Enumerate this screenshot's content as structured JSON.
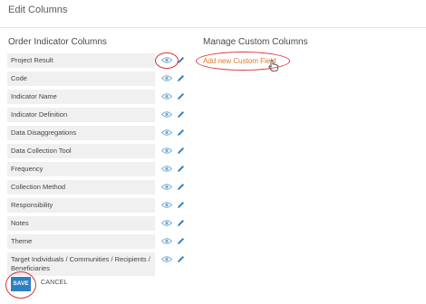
{
  "header": {
    "title": "Edit Columns"
  },
  "order_section": {
    "title": "Order Indicator Columns",
    "columns": [
      {
        "label": "Project Result"
      },
      {
        "label": "Code"
      },
      {
        "label": "Indicator Name"
      },
      {
        "label": "Indicator Definition"
      },
      {
        "label": "Data Disaggregations"
      },
      {
        "label": "Data Collection Tool"
      },
      {
        "label": "Frequency"
      },
      {
        "label": "Collection Method"
      },
      {
        "label": "Responsibility"
      },
      {
        "label": "Notes"
      },
      {
        "label": "Theme"
      },
      {
        "label": "Target Individuals / Communities / Recipients / Beneficiaries"
      }
    ]
  },
  "custom_section": {
    "title": "Manage Custom Columns",
    "add_link": "Add new Custom Field"
  },
  "footer": {
    "save_label": "SAVE",
    "cancel_label": "CANCEL"
  },
  "icons": {
    "eye": "eye-icon",
    "pencil": "pencil-icon",
    "cursor": "hand-pointer-icon"
  },
  "colors": {
    "accent": "#2d7fc1",
    "link": "#e07a1f",
    "annotation": "#d9343b",
    "icon": "#7aaed6",
    "row_bg": "#f0f0f0"
  }
}
